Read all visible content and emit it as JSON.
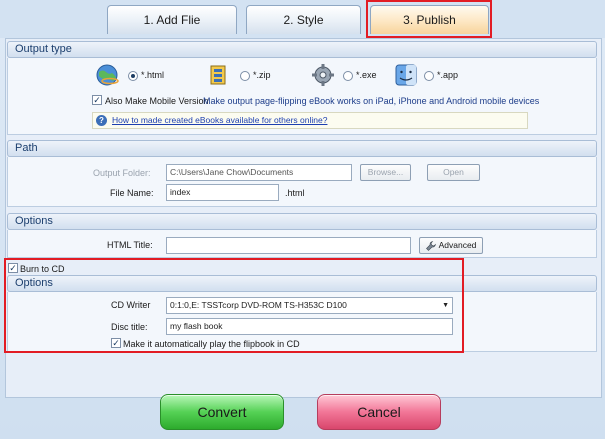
{
  "tabs": [
    {
      "label": "1. Add Flie"
    },
    {
      "label": "2. Style"
    },
    {
      "label": "3. Publish"
    }
  ],
  "output_type": {
    "header": "Output type",
    "formats": [
      {
        "label": "*.html",
        "selected": true,
        "icon": "globe-icon"
      },
      {
        "label": "*.zip",
        "selected": false,
        "icon": "zip-archive-icon"
      },
      {
        "label": "*.exe",
        "selected": false,
        "icon": "gear-exe-icon"
      },
      {
        "label": "*.app",
        "selected": false,
        "icon": "mac-finder-icon"
      }
    ],
    "mobile_checkbox_label": "Also Make Mobile Version",
    "mobile_checked": true,
    "mobile_description": "Make output page-flipping eBook works on iPad, iPhone and Android mobile devices",
    "help_link": "How to made created eBooks available for others online?"
  },
  "path": {
    "header": "Path",
    "output_folder_label": "Output Folder:",
    "output_folder_value": "C:\\Users\\Jane Chow\\Documents",
    "browse_label": "Browse...",
    "open_label": "Open",
    "file_name_label": "File Name:",
    "file_name_value": "index",
    "file_ext": ".html"
  },
  "options": {
    "header": "Options",
    "html_title_label": "HTML Title:",
    "html_title_value": "",
    "advanced_label": "Advanced"
  },
  "burn": {
    "checkbox_label": "Burn to CD",
    "checked": true,
    "header": "Options",
    "cd_writer_label": "CD Writer",
    "cd_writer_value": "0:1:0,E: TSSTcorp DVD-ROM TS-H353C D100",
    "disc_title_label": "Disc title:",
    "disc_title_value": "my flash book",
    "autoplay_label": "Make it automatically play the flipbook in CD",
    "autoplay_checked": true
  },
  "actions": {
    "convert_label": "Convert",
    "cancel_label": "Cancel"
  },
  "colors": {
    "highlight": "#e21c24",
    "convert": "#3cc13c",
    "cancel": "#e9587e"
  }
}
